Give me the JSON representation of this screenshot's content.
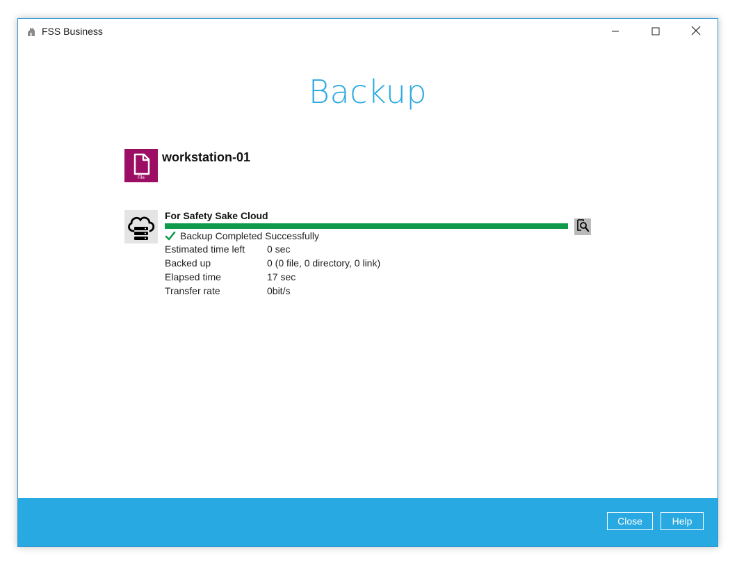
{
  "window": {
    "title": "FSS Business"
  },
  "page": {
    "heading": "Backup"
  },
  "backup_set": {
    "name": "workstation-01",
    "icon_label": "File",
    "icon_color": "#9c0e63"
  },
  "destination": {
    "name": "For Safety Sake Cloud",
    "progress_percent": 100,
    "progress_color": "#0f9a4b",
    "status": "Backup Completed Successfully",
    "details": [
      {
        "label": "Estimated time left",
        "value": "0 sec"
      },
      {
        "label": "Backed up",
        "value": "0 (0 file, 0 directory, 0 link)"
      },
      {
        "label": "Elapsed time",
        "value": "17 sec"
      },
      {
        "label": "Transfer rate",
        "value": "0bit/s"
      }
    ]
  },
  "footer": {
    "close_label": "Close",
    "help_label": "Help",
    "background_color": "#29a9e1"
  },
  "colors": {
    "accent": "#29a9e1",
    "success": "#0f9a4b"
  },
  "icons": {
    "app": "app-logo-icon",
    "minimize": "minimize-icon",
    "maximize": "maximize-icon",
    "close": "close-icon",
    "backup_set": "file-icon",
    "destination": "cloud-server-icon",
    "status": "checkmark-icon",
    "detail": "magnify-report-icon"
  }
}
